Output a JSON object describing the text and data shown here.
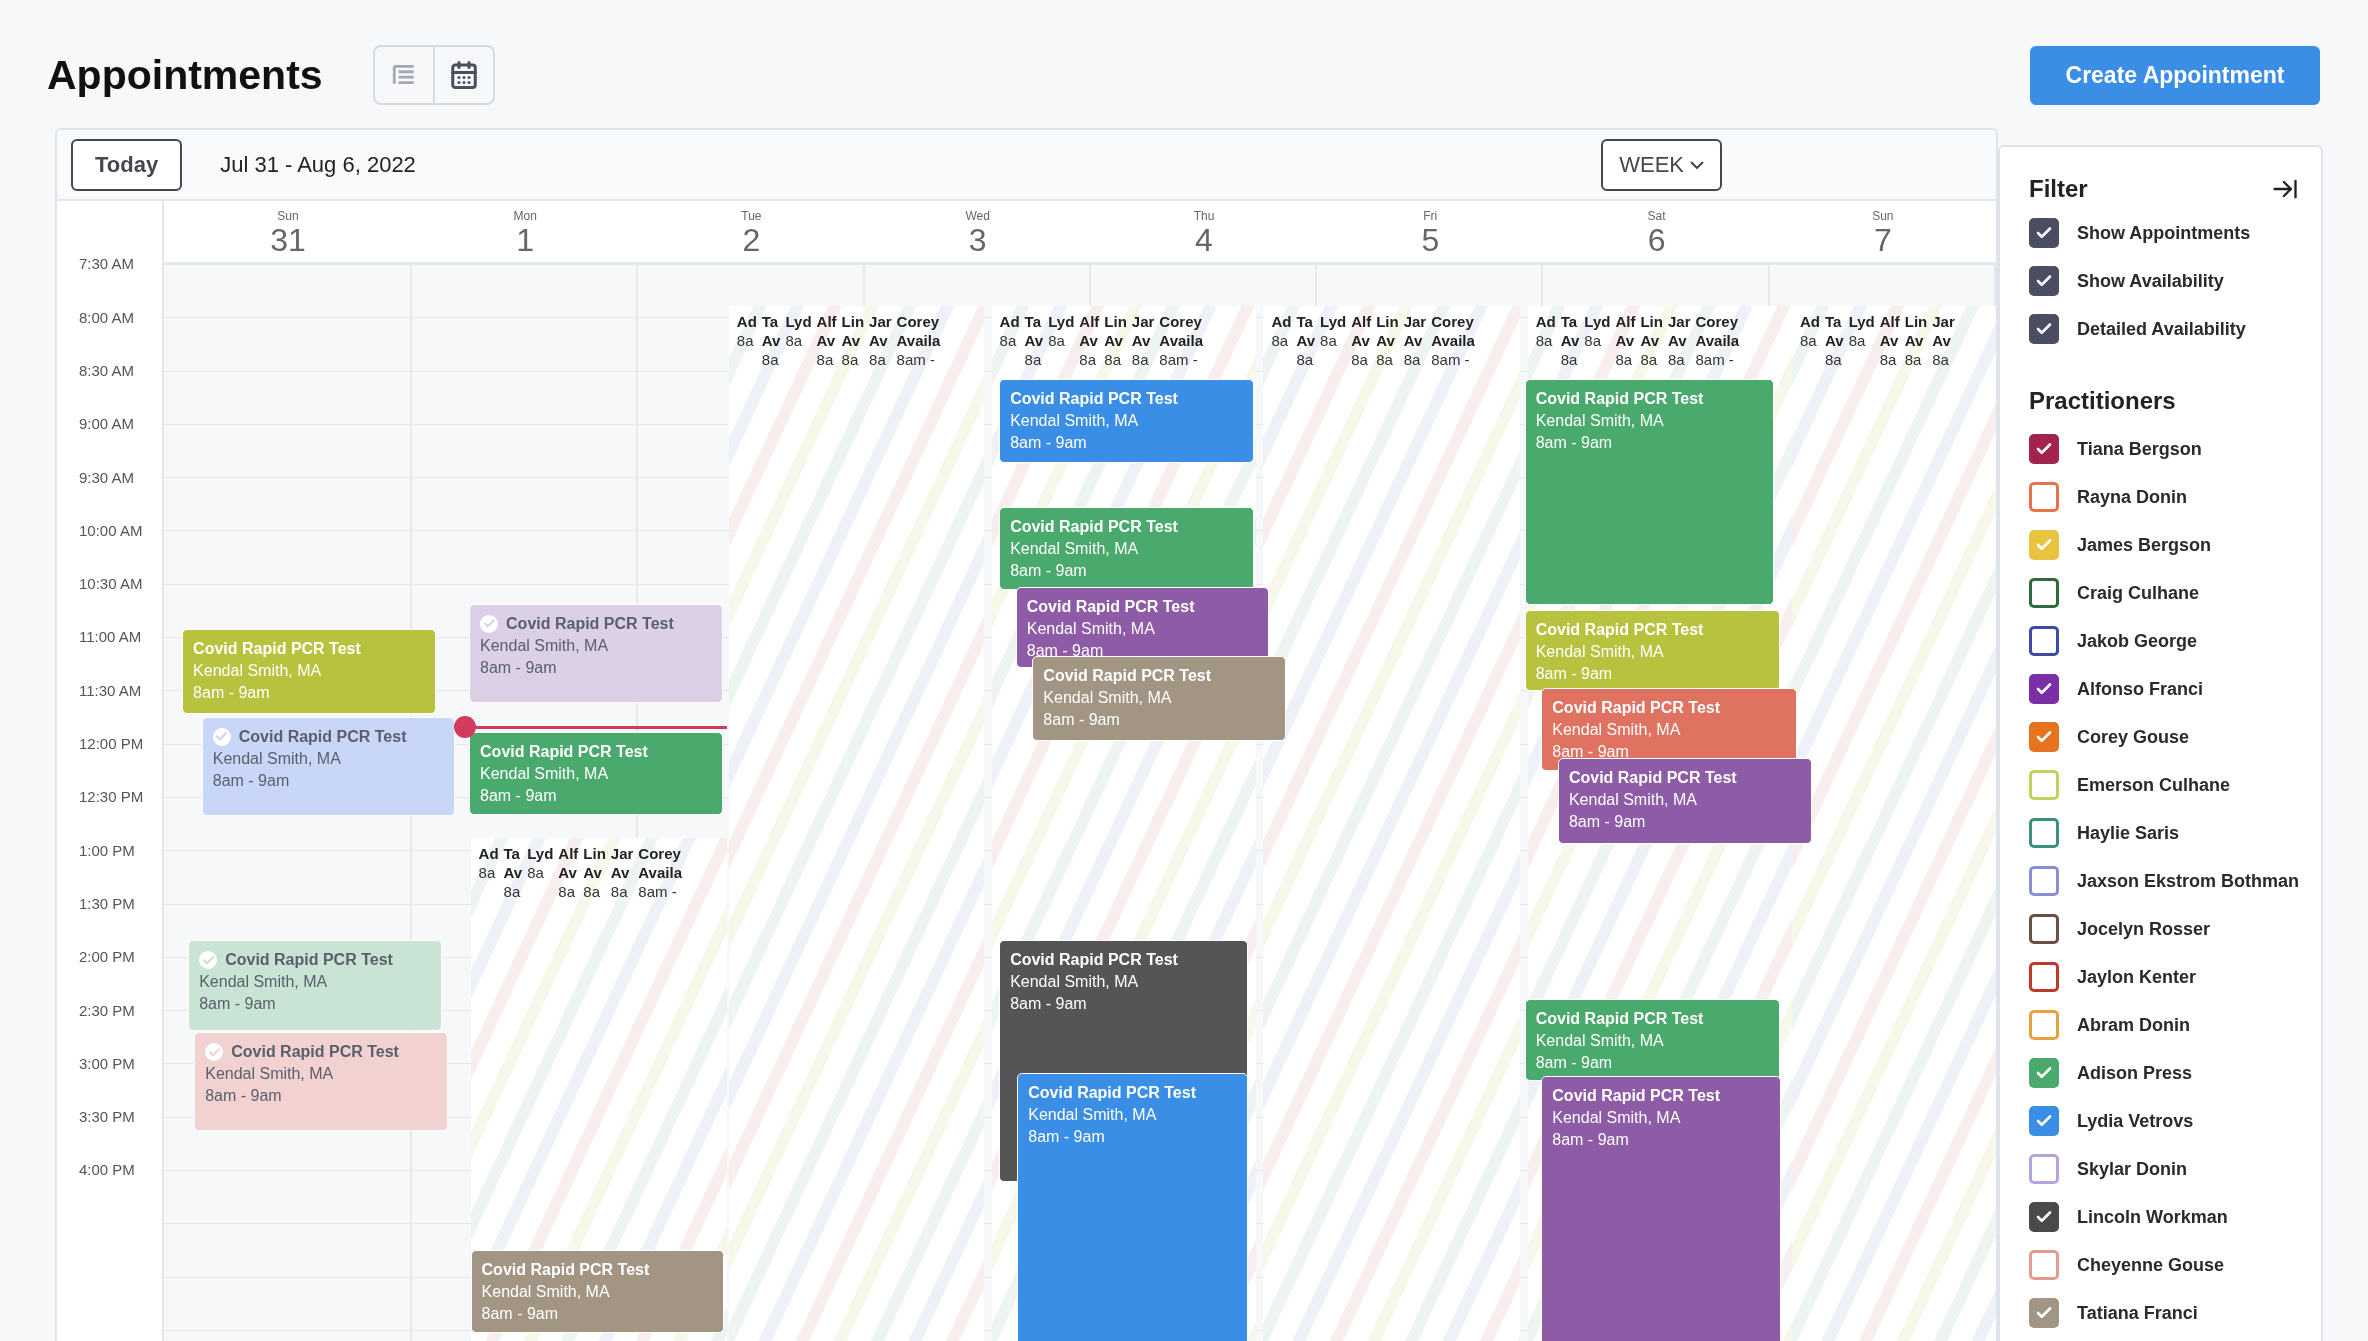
{
  "header": {
    "title": "Appointments",
    "view_toggle": [
      {
        "kind": "list",
        "selected": false
      },
      {
        "kind": "calendar",
        "selected": true
      }
    ],
    "create_button": "Create Appointment"
  },
  "toolbar": {
    "today_button": "Today",
    "date_range": "Jul 31 - Aug 6, 2022",
    "view_select": "WEEK"
  },
  "calendar": {
    "days": [
      {
        "weekday": "Sun",
        "date": "31"
      },
      {
        "weekday": "Mon",
        "date": "1"
      },
      {
        "weekday": "Tue",
        "date": "2"
      },
      {
        "weekday": "Wed",
        "date": "3"
      },
      {
        "weekday": "Thu",
        "date": "4"
      },
      {
        "weekday": "Fri",
        "date": "5"
      },
      {
        "weekday": "Sat",
        "date": "6"
      },
      {
        "weekday": "Sun",
        "date": "7"
      }
    ],
    "time_labels": [
      "7:30 AM",
      "8:00 AM",
      "8:30 AM",
      "9:00 AM",
      "9:30 AM",
      "10:00 AM",
      "10:30 AM",
      "11:00 AM",
      "11:30 AM",
      "12:00 PM",
      "12:30 PM",
      "1:00 PM",
      "1:30 PM",
      "2:00 PM",
      "2:30 PM",
      "3:00 PM",
      "3:30 PM",
      "4:00 PM"
    ],
    "availability": [
      {
        "columns": [
          {
            "name": "Ad",
            "time": "8a"
          },
          {
            "name": "Ta",
            "label": "Av",
            "time": "8a"
          },
          {
            "name": "Lyd",
            "time": "8a"
          },
          {
            "name": "Alf",
            "label": "Av",
            "time": "8a"
          },
          {
            "name": "Lin",
            "label": "Av",
            "time": "8a"
          },
          {
            "name": "Jar",
            "label": "Av",
            "time": "8a"
          },
          {
            "name": "Corey",
            "label": "Availa",
            "time": "8am -"
          }
        ]
      },
      {
        "columns": [
          {
            "name": "Ad",
            "time": "8a"
          },
          {
            "name": "Ta",
            "label": "Av",
            "time": "8a"
          },
          {
            "name": "Lyd",
            "time": "8a"
          },
          {
            "name": "Alf",
            "label": "Av",
            "time": "8a"
          },
          {
            "name": "Lin",
            "label": "Av",
            "time": "8a"
          },
          {
            "name": "Jar",
            "label": "Av",
            "time": "8a"
          },
          {
            "name": "Corey",
            "label": "Availa",
            "time": "8am -"
          }
        ]
      },
      {
        "columns": [
          {
            "name": "Ad",
            "time": "8a"
          },
          {
            "name": "Ta",
            "label": "Av",
            "time": "8a"
          },
          {
            "name": "Lyd",
            "time": "8a"
          },
          {
            "name": "Alf",
            "label": "Av",
            "time": "8a"
          },
          {
            "name": "Lin",
            "label": "Av",
            "time": "8a"
          },
          {
            "name": "Jar",
            "label": "Av",
            "time": "8a"
          },
          {
            "name": "Corey",
            "label": "Availa",
            "time": "8am -"
          }
        ]
      },
      {
        "columns": [
          {
            "name": "Ad",
            "time": "8a"
          },
          {
            "name": "Ta",
            "label": "Av",
            "time": "8a"
          },
          {
            "name": "Lyd",
            "time": "8a"
          },
          {
            "name": "Alf",
            "label": "Av",
            "time": "8a"
          },
          {
            "name": "Lin",
            "label": "Av",
            "time": "8a"
          },
          {
            "name": "Jar",
            "label": "Av",
            "time": "8a"
          },
          {
            "name": "Corey",
            "label": "Availa",
            "time": "8am -"
          }
        ]
      },
      {
        "columns": [
          {
            "name": "Ad",
            "time": "8a"
          },
          {
            "name": "Ta",
            "label": "Av",
            "time": "8a"
          },
          {
            "name": "Lyd",
            "time": "8a"
          },
          {
            "name": "Alf",
            "label": "Av",
            "time": "8a"
          },
          {
            "name": "Lin",
            "label": "Av",
            "time": "8a"
          },
          {
            "name": "Jar",
            "label": "Av",
            "time": "8a"
          }
        ]
      },
      {
        "columns": [
          {
            "name": "Ad",
            "time": "8a"
          },
          {
            "name": "Ta",
            "label": "Av",
            "time": "8a"
          },
          {
            "name": "Lyd",
            "time": "8a"
          },
          {
            "name": "Alf",
            "label": "Av",
            "time": "8a"
          },
          {
            "name": "Lin",
            "label": "Av",
            "time": "8a"
          },
          {
            "name": "Jar",
            "label": "Av",
            "time": "8a"
          },
          {
            "name": "Corey",
            "label": "Availa",
            "time": "8am -"
          }
        ]
      }
    ],
    "events": [
      {
        "title": "Covid Rapid PCR Test",
        "provider": "Kendal Smith, MA",
        "time": "8am - 9am",
        "color": "#3a8ee6",
        "completed": false
      },
      {
        "title": "Covid Rapid PCR Test",
        "provider": "Kendal Smith, MA",
        "time": "8am - 9am",
        "color": "#4aa96c",
        "completed": false
      },
      {
        "title": "Covid Rapid PCR Test",
        "provider": "Kendal Smith, MA",
        "time": "8am - 9am",
        "color": "#4aa96c",
        "completed": false
      },
      {
        "title": "Covid Rapid PCR Test",
        "provider": "Kendal Smith, MA",
        "time": "8am - 9am",
        "color": "#8e5ba6",
        "completed": false
      },
      {
        "title": "Covid Rapid PCR Test",
        "provider": "Kendal Smith, MA",
        "time": "8am - 9am",
        "color": "#dcd0e6",
        "completed": true
      },
      {
        "title": "Covid Rapid PCR Test",
        "provider": "Kendal Smith, MA",
        "time": "8am - 9am",
        "color": "#b8c23e",
        "completed": false
      },
      {
        "title": "Covid Rapid PCR Test",
        "provider": "Kendal Smith, MA",
        "time": "8am - 9am",
        "color": "#b8c23e",
        "completed": false
      },
      {
        "title": "Covid Rapid PCR Test",
        "provider": "Kendal Smith, MA",
        "time": "8am - 9am",
        "color": "#a39584",
        "completed": false
      },
      {
        "title": "Covid Rapid PCR Test",
        "provider": "Kendal Smith, MA",
        "time": "8am - 9am",
        "color": "#df7260",
        "completed": false
      },
      {
        "title": "Covid Rapid PCR Test",
        "provider": "Kendal Smith, MA",
        "time": "8am - 9am",
        "color": "#c8d6f7",
        "completed": true
      },
      {
        "title": "Covid Rapid PCR Test",
        "provider": "Kendal Smith, MA",
        "time": "8am - 9am",
        "color": "#4aa96c",
        "completed": false
      },
      {
        "title": "Covid Rapid PCR Test",
        "provider": "Kendal Smith, MA",
        "time": "8am - 9am",
        "color": "#8e5ba6",
        "completed": false
      },
      {
        "title": "Covid Rapid PCR Test",
        "provider": "Kendal Smith, MA",
        "time": "8am - 9am",
        "color": "#c9e4d4",
        "completed": true
      },
      {
        "title": "Covid Rapid PCR Test",
        "provider": "Kendal Smith, MA",
        "time": "8am - 9am",
        "color": "#555555",
        "completed": false
      },
      {
        "title": "Covid Rapid PCR Test",
        "provider": "Kendal Smith, MA",
        "time": "8am - 9am",
        "color": "#4aa96c",
        "completed": false
      },
      {
        "title": "Covid Rapid PCR Test",
        "provider": "Kendal Smith, MA",
        "time": "8am - 9am",
        "color": "#f2d2d0",
        "completed": true
      },
      {
        "title": "Covid Rapid PCR Test",
        "provider": "Kendal Smith, MA",
        "time": "8am - 9am",
        "color": "#3a8ee6",
        "completed": false
      },
      {
        "title": "Covid Rapid PCR Test",
        "provider": "Kendal Smith, MA",
        "time": "8am - 9am",
        "color": "#8e5ba6",
        "completed": false
      },
      {
        "title": "Covid Rapid PCR Test",
        "provider": "Kendal Smith, MA",
        "time": "8am - 9am",
        "color": "#a39584",
        "completed": false
      }
    ]
  },
  "filter": {
    "title": "Filter",
    "options": [
      {
        "label": "Show Appointments",
        "checked": true
      },
      {
        "label": "Show Availability",
        "checked": true
      },
      {
        "label": "Detailed Availability",
        "checked": true
      }
    ]
  },
  "practitioners": {
    "title": "Practitioners",
    "items": [
      {
        "name": "Tiana Bergson",
        "color": "#a3234f",
        "checked": true
      },
      {
        "name": "Rayna Donin",
        "color": "#e8734a",
        "checked": false
      },
      {
        "name": "James Bergson",
        "color": "#e8c440",
        "checked": true
      },
      {
        "name": "Craig Culhane",
        "color": "#2e6b3a",
        "checked": false
      },
      {
        "name": "Jakob George",
        "color": "#3d4aa8",
        "checked": false
      },
      {
        "name": "Alfonso Franci",
        "color": "#7a2fa6",
        "checked": true
      },
      {
        "name": "Corey Gouse",
        "color": "#e8731f",
        "checked": true
      },
      {
        "name": "Emerson Culhane",
        "color": "#c2d15a",
        "checked": false
      },
      {
        "name": "Haylie Saris",
        "color": "#3a8f7f",
        "checked": false
      },
      {
        "name": "Jaxson Ekstrom Bothman",
        "color": "#8a8fd1",
        "checked": false
      },
      {
        "name": "Jocelyn Rosser",
        "color": "#6b4e44",
        "checked": false
      },
      {
        "name": "Jaylon Kenter",
        "color": "#c0392b",
        "checked": false
      },
      {
        "name": "Abram Donin",
        "color": "#e6a23c",
        "checked": false
      },
      {
        "name": "Adison Press",
        "color": "#4aa96c",
        "checked": true
      },
      {
        "name": "Lydia Vetrovs",
        "color": "#3a8ee6",
        "checked": true
      },
      {
        "name": "Skylar Donin",
        "color": "#b7a3dd",
        "checked": false
      },
      {
        "name": "Lincoln Workman",
        "color": "#4a4a4a",
        "checked": true
      },
      {
        "name": "Cheyenne Gouse",
        "color": "#e39a8f",
        "checked": false
      },
      {
        "name": "Tatiana Franci",
        "color": "#a39584",
        "checked": true
      }
    ]
  }
}
